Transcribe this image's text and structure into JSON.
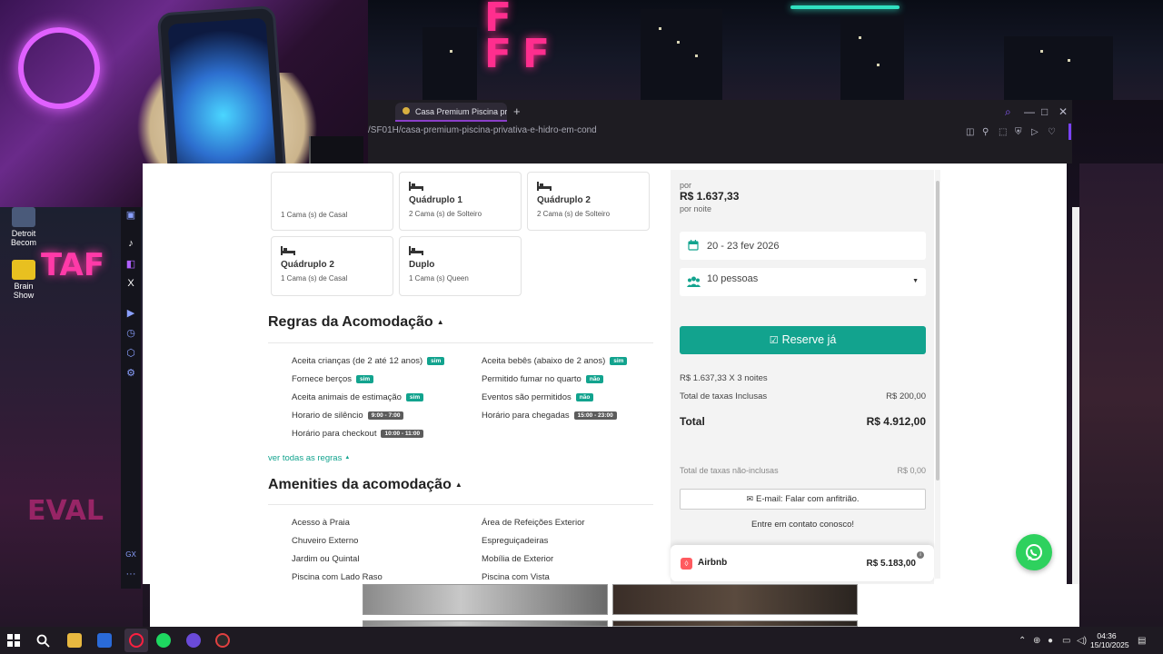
{
  "browser": {
    "tab_title": "Casa Premium Piscina pri",
    "new_tab": "+",
    "url": "/SF01H/casa-premium-piscina-privativa-e-hidro-em-cond"
  },
  "desktop": {
    "icons": [
      {
        "label": "Detroit Becom"
      },
      {
        "label": "Brain Show"
      }
    ],
    "sidebar_labels": [
      "GX",
      "···",
      "GX",
      "···"
    ]
  },
  "rooms": [
    {
      "title": "",
      "beds": "1 Cama (s) de Casal"
    },
    {
      "title": "Quádruplo 1",
      "beds": "2 Cama (s) de Solteiro"
    },
    {
      "title": "Quádruplo 2",
      "beds": "2 Cama (s) de Solteiro"
    },
    {
      "title": "Quádruplo 2",
      "beds": "1 Cama (s) de Casal"
    },
    {
      "title": "Duplo",
      "beds": "1 Cama (s) Queen"
    }
  ],
  "rules": {
    "heading": "Regras da Acomodação",
    "items": [
      {
        "label": "Aceita crianças (de 2 até 12 anos)",
        "badge": "sim"
      },
      {
        "label": "Aceita bebês (abaixo de 2 anos)",
        "badge": "sim"
      },
      {
        "label": "Fornece berços",
        "badge": "sim"
      },
      {
        "label": "Permitido fumar no quarto",
        "badge": "não"
      },
      {
        "label": "Aceita animais de estimação",
        "badge": "sim"
      },
      {
        "label": "Eventos são permitidos",
        "badge": "não"
      },
      {
        "label": "Horario de silêncio",
        "badge": "9:00 - 7:00"
      },
      {
        "label": "Horário para chegadas",
        "badge": "15:00 - 23:00"
      },
      {
        "label": "Horário para checkout",
        "badge": "10:00 - 11:00"
      }
    ],
    "see_all": "ver todas as regras"
  },
  "amenities": {
    "heading": "Amenities da acomodação",
    "items": [
      "Acesso à Praia",
      "Área de Refeições Exterior",
      "Chuveiro Externo",
      "Espreguiçadeiras",
      "Jardim ou Quintal",
      "Mobília de Exterior",
      "Piscina com Lado Raso",
      "Piscina com Vista"
    ]
  },
  "booking": {
    "por": "por",
    "price": "R$ 1.637,33",
    "per_night": "por noite",
    "dates": "20 - 23 fev 2026",
    "guests": "10 pessoas",
    "reserve": "Reserve já",
    "nights_line": "R$ 1.637,33 X 3 noites",
    "taxes_label": "Total de taxas Inclusas",
    "taxes_value": "R$ 200,00",
    "total_label": "Total",
    "total_value": "R$ 4.912,00",
    "excluded_label": "Total de taxas não-inclusas",
    "excluded_value": "R$ 0,00",
    "email_button": "E-mail: Falar com anfitrião.",
    "contact": "Entre em contato conosco!",
    "airbnb_label": "Airbnb",
    "airbnb_price": "R$ 5.183,00"
  },
  "taskbar": {
    "time": "04:36",
    "date": "15/10/2025"
  },
  "colors": {
    "accent": "#12a38e",
    "whatsapp": "#2ed15e",
    "browser_accent": "#8a3ec8"
  }
}
